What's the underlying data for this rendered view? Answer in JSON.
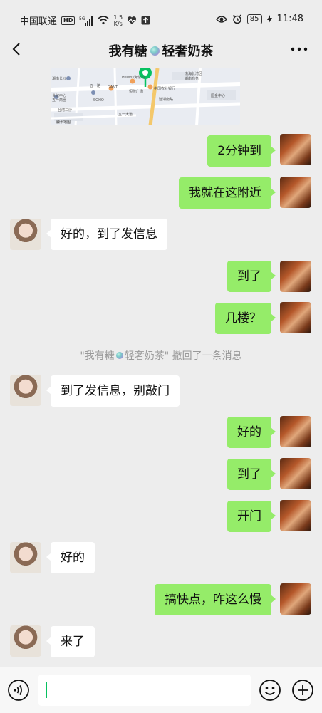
{
  "status_bar": {
    "carrier": "中国联通",
    "hd": "HD",
    "signal_label": "5G",
    "net_speed_value": "1.5",
    "net_speed_unit": "K/s",
    "battery": "85",
    "time": "11:48"
  },
  "header": {
    "title_part1": "我有糖",
    "title_part2": "轻奢奶茶"
  },
  "map": {
    "labels": [
      "Helens海伦司",
      "渤海长湾区",
      "湖南长沙",
      "恒隆广场",
      "中国农业银行",
      "湖南商务",
      "五一路",
      "SOHO",
      "GANT",
      "世纪中心",
      "五一商圈",
      "腾讯地图",
      "建湘南路",
      "五一大道",
      "国金中心",
      "台湾三沙"
    ]
  },
  "messages": [
    {
      "from": "me",
      "text": "2分钟到"
    },
    {
      "from": "me",
      "text": "我就在这附近"
    },
    {
      "from": "her",
      "text": "好的，到了发信息"
    },
    {
      "from": "me",
      "text": "到了"
    },
    {
      "from": "me",
      "text": "几楼？"
    },
    {
      "from": "her",
      "text": "到了发信息，别敲门"
    },
    {
      "from": "me",
      "text": "好的"
    },
    {
      "from": "me",
      "text": "到了"
    },
    {
      "from": "me",
      "text": "开门"
    },
    {
      "from": "her",
      "text": "好的"
    },
    {
      "from": "me",
      "text": "搞快点，咋这么慢"
    },
    {
      "from": "her",
      "text": "来了"
    }
  ],
  "system_notice": {
    "prefix": "\"我有糖",
    "suffix": "轻奢奶茶\" 撤回了一条消息"
  },
  "input": {
    "value": ""
  },
  "colors": {
    "my_bubble": "#95ec69",
    "her_bubble": "#ffffff",
    "background": "#ededed",
    "accent": "#07c160"
  },
  "icons": [
    "back-arrow-icon",
    "more-icon",
    "voice-icon",
    "emoji-icon",
    "plus-icon",
    "eye-icon",
    "alarm-icon",
    "wifi-icon",
    "signal-icon",
    "heart-icon",
    "upload-icon",
    "charging-icon",
    "map-pin-icon"
  ]
}
